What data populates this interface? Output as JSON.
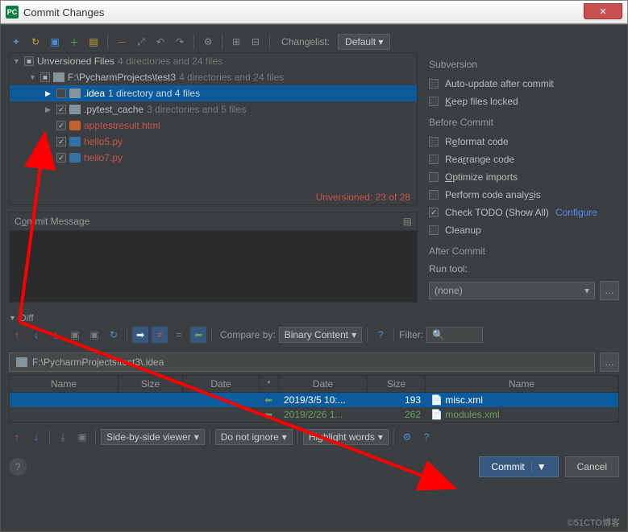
{
  "window": {
    "title": "Commit Changes"
  },
  "toolbar": {
    "changelist_label": "Changelist:",
    "changelist_value": "Default"
  },
  "tree": {
    "root": {
      "label": "Unversioned Files",
      "info": "4 directories and 24 files"
    },
    "proj": {
      "label": "F:\\PycharmProjects\\test3",
      "info": "4 directories and 24 files"
    },
    "idea": {
      "label": ".idea",
      "info": "1 directory and 4 files"
    },
    "pytest": {
      "label": ".pytest_cache",
      "info": "3 directories and 5 files"
    },
    "f1": "apptestresult.html",
    "f2": "hello5.py",
    "f3": "hello7.py",
    "status": "Unversioned: 23 of 28"
  },
  "commit_message": {
    "label": "Commit Message"
  },
  "subversion": {
    "header": "Subversion",
    "auto_update": "Auto-update after commit",
    "keep_locked": "Keep files locked"
  },
  "before": {
    "header": "Before Commit",
    "reformat": "Reformat code",
    "rearrange": "Rearrange code",
    "optimize": "Optimize imports",
    "analysis": "Perform code analysis",
    "todo": "Check TODO (Show All)",
    "configure": "Configure",
    "cleanup": "Cleanup"
  },
  "after": {
    "header": "After Commit",
    "run_tool": "Run tool:",
    "none": "(none)"
  },
  "diff": {
    "header": "Diff",
    "compare_by": "Compare by:",
    "binary": "Binary Content",
    "filter": "Filter:",
    "path": "F:\\PycharmProjects\\test3\\.idea",
    "cols": {
      "name": "Name",
      "size": "Size",
      "date": "Date",
      "star": "*"
    },
    "r1": {
      "date": "2019/3/5 10:...",
      "size": "193",
      "name": "misc.xml"
    },
    "r2": {
      "date": "2019/2/26 1...",
      "size": "262",
      "name": "modules.xml"
    }
  },
  "bottom": {
    "viewer": "Side-by-side viewer",
    "ignore": "Do not ignore",
    "highlight": "Highlight words"
  },
  "footer": {
    "commit": "Commit",
    "cancel": "Cancel"
  },
  "watermark": "©51CTO博客"
}
